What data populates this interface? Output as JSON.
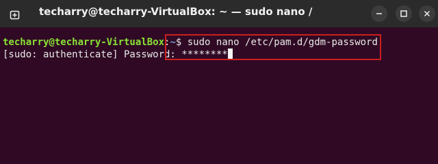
{
  "window": {
    "title": "techarry@techarry-VirtualBox: ~ — sudo nano /etc/p..."
  },
  "terminal": {
    "prompt_user_host": "techarry@techarry-VirtualBox",
    "prompt_colon": ":",
    "prompt_path": "~",
    "prompt_symbol": "$",
    "command": " sudo nano /etc/pam.d/gdm-password",
    "sudo_prompt": "[sudo: authenticate] Password:",
    "password_mask": " ********"
  },
  "icons": {
    "new_tab": "new-tab-icon",
    "minimize": "minimize-icon",
    "maximize": "maximize-icon",
    "close": "close-icon"
  },
  "colors": {
    "terminal_bg": "#300a24",
    "prompt_user": "#8ae234",
    "prompt_path": "#729fcf",
    "highlight_border": "#cc1f1f"
  }
}
